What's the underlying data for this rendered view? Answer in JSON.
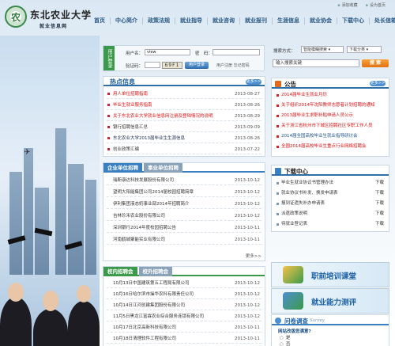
{
  "brand": {
    "title": "东北农业大学",
    "subtitle": "就业信息网",
    "logo_char": "农"
  },
  "toplinks": [
    "添加收藏",
    "设为首页"
  ],
  "nav": [
    "首页",
    "中心简介",
    "政策法规",
    "就业指导",
    "就业咨询",
    "就业报刊",
    "生涯信息",
    "就业协会",
    "下载中心",
    "处长信箱"
  ],
  "login": {
    "tag": "用户登录",
    "username_label": "用户名：",
    "username_value": "view",
    "password_label": "密　码：",
    "captcha_label": "验证码：",
    "captcha_text": "69F1",
    "login_button": "用户登录",
    "links": "用户注册  忘记密码"
  },
  "search": {
    "label": "搜索方式：",
    "mode": "智能模糊搜索",
    "scope": "下载分类",
    "placeholder": "输入搜索关键",
    "button": "搜 索"
  },
  "hot": {
    "title": "热点信息",
    "more": "更多>>",
    "items": [
      {
        "text": "用人单位招聘指南",
        "date": "2013-08-27",
        "style": "red"
      },
      {
        "text": "毕业生就业服务指南",
        "date": "2013-08-26",
        "style": "red"
      },
      {
        "text": "关于东北农业大学就业信息网注册及登陆情况的说明",
        "date": "2013-08-29",
        "style": "red"
      },
      {
        "text": "银行招聘信息汇总",
        "date": "2013-09-09",
        "style": ""
      },
      {
        "text": "东北农业大学2013届毕业生生源信息",
        "date": "2013-08-26",
        "style": "blue"
      },
      {
        "text": "创业政策汇编",
        "date": "2013-07-22",
        "style": ""
      }
    ]
  },
  "notice": {
    "title": "公告",
    "more": "更多>>",
    "items": [
      {
        "text": "2014届毕业生就业月历",
        "style": "red"
      },
      {
        "text": "关于组织2014年沈阳教师志愿者计划招聘的通知",
        "style": "red"
      },
      {
        "text": "2013届毕业生求职补贴申请人员公示",
        "style": "red"
      },
      {
        "text": "关于浙江省杭州市下城区招聘社区专职工作人员",
        "style": "red"
      },
      {
        "text": "2014届全国高校毕业生就业指导研讨会",
        "style": "blue"
      },
      {
        "text": "全国2014届高校毕业生重点行业网络招聘会",
        "style": "red"
      }
    ]
  },
  "company": {
    "tab_on": "企业单位招聘",
    "tab_off": "事业单位招聘",
    "more": "更多>>",
    "items": [
      {
        "text": "瑞斯康达科技发展股份有限公司",
        "date": "2013-10-12"
      },
      {
        "text": "望明大阳能集团公司2014届校园招聘简章",
        "date": "2013-10-12"
      },
      {
        "text": "伊利集团液态奶事业部2014年招聘简介",
        "date": "2013-10-12"
      },
      {
        "text": "吉林珍禾农业股份有限公司",
        "date": "2013-10-12"
      },
      {
        "text": "深圳银行2014年度校园招聘公告",
        "date": "2013-10-11"
      },
      {
        "text": "河南鹤城聚能实业有限公司",
        "date": "2013-10-11"
      }
    ]
  },
  "downloads": {
    "title": "下载中心",
    "items": [
      {
        "text": "毕业生就业协议书管理办法",
        "act": "下载"
      },
      {
        "text": "就业协议书补发、换发申请表",
        "act": "下载"
      },
      {
        "text": "报到证遗失补办申请表",
        "act": "下载"
      },
      {
        "text": "派遣政策说明",
        "act": "下载"
      },
      {
        "text": "待就业登记表",
        "act": "下载"
      }
    ]
  },
  "campus": {
    "tab_on": "校内招聘会",
    "tab_off": "校外招聘会",
    "items": [
      {
        "text": "10月13日中国建筑第五工程局有限公司",
        "date": "2013-10-12"
      },
      {
        "text": "10月16日哈尔滨市操华农科有限责任公司",
        "date": "2013-10-12"
      },
      {
        "text": "10月14日江河创建集团股份有限公司",
        "date": "2013-10-12"
      },
      {
        "text": "11月5日黑龙江富霖农业综合服务连锁有限公司",
        "date": "2013-10-12"
      },
      {
        "text": "10月17日北京高新科技有限公司",
        "date": "2013-10-11"
      },
      {
        "text": "10月18日清理软件工程有限公司",
        "date": "2013-10-11"
      }
    ]
  },
  "banners": [
    "职前培训课堂",
    "就业能力测评"
  ],
  "survey": {
    "title": "问卷调查",
    "sub": "Survey",
    "question": "网站改版您满意?",
    "options": [
      "是",
      "否"
    ]
  },
  "colors": {
    "accent": "#2f6fa8",
    "green": "#3b9a4a",
    "red": "#d11111"
  }
}
